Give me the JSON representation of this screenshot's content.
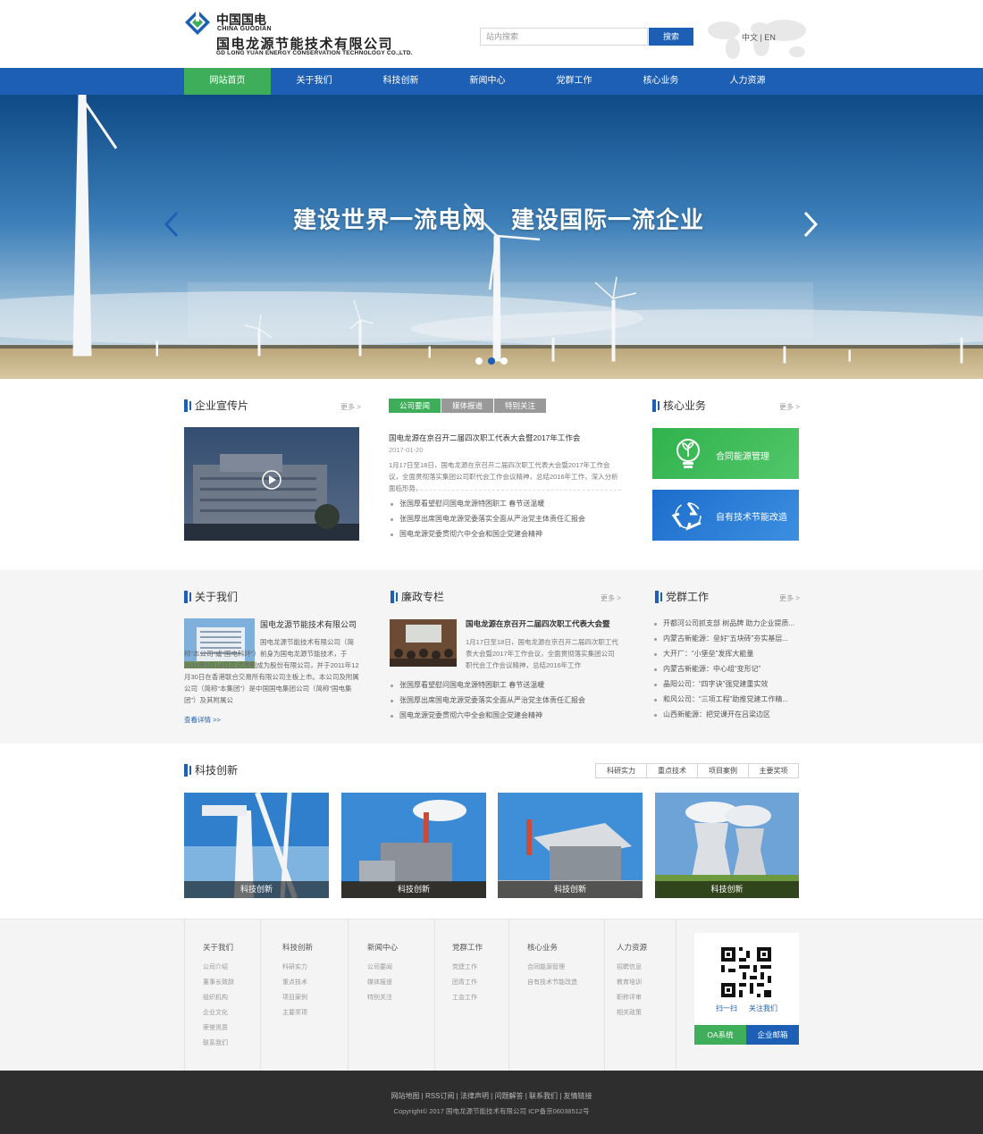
{
  "header": {
    "logo_cn": "中国国电",
    "logo_en": "CHINA GUODIAN",
    "company_cn": "国电龙源节能技术有限公司",
    "company_en": "GD LONG YUAN ENERGY CONSERVATION TECHNOLOGY CO.,LTD.",
    "search_placeholder": "站内搜索",
    "search_button": "搜索",
    "lang": "中文 | EN"
  },
  "nav": [
    "网站首页",
    "关于我们",
    "科技创新",
    "新闻中心",
    "党群工作",
    "核心业务",
    "人力资源"
  ],
  "banner": {
    "slogan1": "建设世界一流电网",
    "slogan2": "建设国际一流企业"
  },
  "video_section": {
    "title": "企业宣传片",
    "more": "更多 >"
  },
  "news_section": {
    "tabs": [
      "公司要闻",
      "媒体报道",
      "特别关注"
    ],
    "headline": "国电龙源在京召开二届四次职工代表大会暨2017年工作会",
    "date": "2017-01-20",
    "summary": "1月17日至18日，国电龙源在京召开二届四次职工代表大会暨2017年工作会议，全面贯彻落实集团公司职代会工作会议精神，总结2016年工作，深入分析面临形势，",
    "items": [
      "张国厚看望慰问国电龙源特困职工 春节送温暖",
      "张国厚出席国电龙源党委落实全面从严治党主体责任汇报会",
      "国电龙源党委贯彻六中全会和国企党建会精神"
    ]
  },
  "core_business": {
    "title": "核心业务",
    "more": "更多 >",
    "cards": [
      "合同能源管理",
      "自有技术节能改造"
    ]
  },
  "about": {
    "title": "关于我们",
    "company": "国电龙源节能技术有限公司",
    "text": "国电龙源节能技术有限公司（简称“本公司”或“国电科环”）前身为国电龙源节能技术，于2011年5月16日正式改制成为股份有限公司，并于2011年12月30日在香港联合交易所有限公司主板上市。本公司及附属公司（简称“本集团”）是中国国电集团公司（简称“国电集团”）及其附属公",
    "more": "查看详情 >>"
  },
  "integrity": {
    "title": "廉政专栏",
    "more": "更多 >",
    "headline": "国电龙源在京召开二届四次职工代表大会暨",
    "summary": "1月17日至18日，国电龙源在京召开二届四次职工代表大会暨2017年工作会议，全面贯彻落实集团公司职代会工作会议精神，总结2016年工作",
    "items": [
      "张国厚看望慰问国电龙源特困职工 春节送温暖",
      "张国厚出席国电龙源党委落实全面从严治党主体责任汇报会",
      "国电龙源党委贯彻六中全会和国企党建会精神"
    ]
  },
  "party": {
    "title": "党群工作",
    "more": "更多 >",
    "items": [
      "开都河公司抓支部 树品牌 助力企业提质...",
      "内蒙古新能源：垒好“五块砖”夯实基层...",
      "大开厂：“小堡垒”发挥大能量",
      "内蒙古新能源：中心组“变形记”",
      "晶阳公司：“四字诀”强党建重实效",
      "和风公司：“三项工程”助推党建工作精...",
      "山西新能源：把党课开在吕梁边区"
    ]
  },
  "tech": {
    "title": "科技创新",
    "buttons": [
      "科研实力",
      "重点技术",
      "项目案例",
      "主要奖项"
    ],
    "captions": [
      "科技创新",
      "科技创新",
      "科技创新",
      "科技创新"
    ]
  },
  "footer": {
    "columns": [
      {
        "title": "关于我们",
        "links": [
          "公司介绍",
          "董事长致辞",
          "组织机构",
          "企业文化",
          "荣誉资质",
          "联系我们"
        ]
      },
      {
        "title": "科技创新",
        "links": [
          "科研实力",
          "重点技术",
          "项目案例",
          "主要奖项"
        ]
      },
      {
        "title": "新闻中心",
        "links": [
          "公司要闻",
          "媒体报道",
          "特别关注"
        ]
      },
      {
        "title": "党群工作",
        "links": [
          "党建工作",
          "团青工作",
          "工会工作"
        ]
      },
      {
        "title": "核心业务",
        "links": [
          "合同能源管理",
          "自有技术节能改造"
        ]
      },
      {
        "title": "人力资源",
        "links": [
          "招聘信息",
          "教育培训",
          "职称评审",
          "相关政策"
        ]
      }
    ],
    "qr_left": "扫一扫",
    "qr_right": "关注我们",
    "oa_button": "OA系统",
    "mail_button": "企业邮箱",
    "bottom_links": "网站地图 | RSS订阅 | 法律声明 | 问题解答 | 联系我们 | 友情链接",
    "copyright": "Copyright© 2017 国电龙源节能技术有限公司 ICP备京06038512号"
  },
  "colors": {
    "brand_blue": "#1d5fb4",
    "brand_green": "#3fae5a"
  }
}
